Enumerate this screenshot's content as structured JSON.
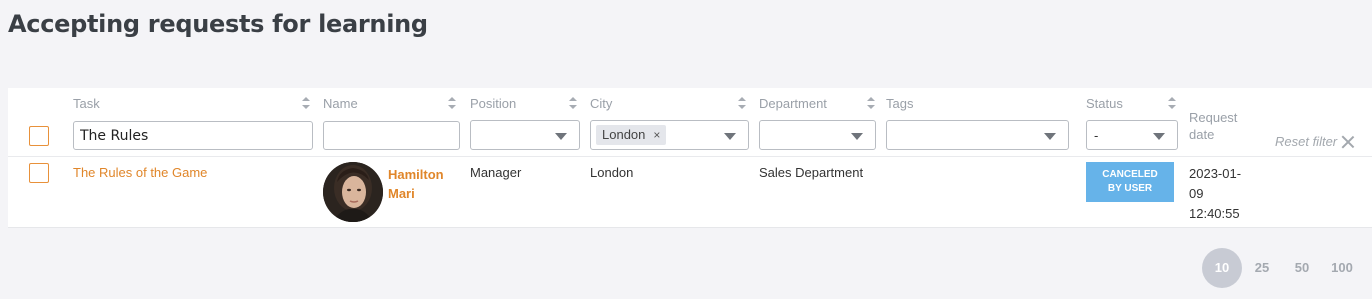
{
  "page": {
    "title": "Accepting requests for learning"
  },
  "columns": {
    "task": "Task",
    "name": "Name",
    "position": "Position",
    "city": "City",
    "department": "Department",
    "tags": "Tags",
    "status": "Status",
    "request_date_line1": "Request",
    "request_date_line2": "date"
  },
  "filters": {
    "task_value": "The Rules",
    "name_value": "",
    "position_value": "",
    "city_chip": "London",
    "city_chip_remove": "×",
    "department_value": "",
    "tags_value": "",
    "status_value": "-",
    "reset_label": "Reset filter"
  },
  "rows": [
    {
      "task": "The Rules of the Game",
      "name_line1": "Hamilton",
      "name_line2": "Mari",
      "position": "Manager",
      "city": "London",
      "department": "Sales Department",
      "tags": "",
      "status_line1": "CANCELED",
      "status_line2": "BY USER",
      "date_line1": "2023-01-",
      "date_line2": "09",
      "date_line3": "12:40:55"
    }
  ],
  "pagination": {
    "sizes": [
      "10",
      "25",
      "50",
      "100"
    ],
    "active": "10"
  },
  "colors": {
    "accent": "#e0862a",
    "status_canceled": "#66b3e9",
    "pager_active": "#c8cbd4"
  }
}
